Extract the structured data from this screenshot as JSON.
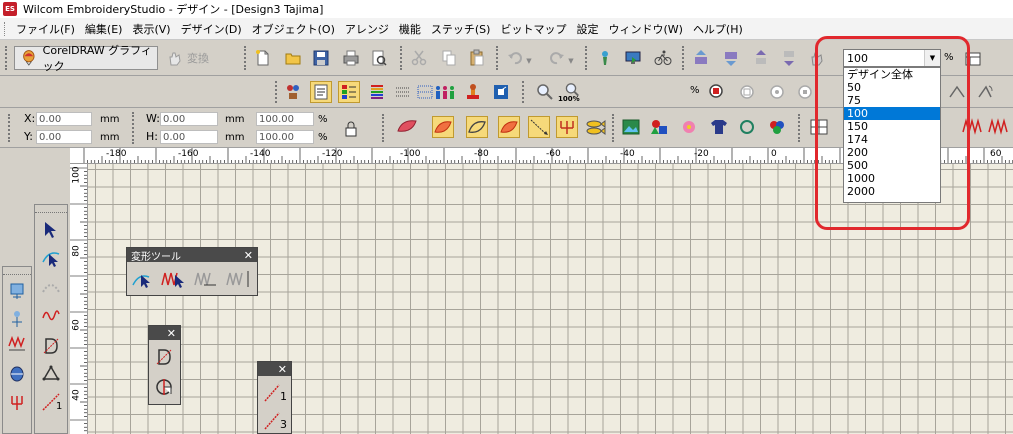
{
  "window": {
    "title": "Wilcom EmbroideryStudio - デザイン - [Design3        Tajima]",
    "logo_text": "ES"
  },
  "menu": [
    "ファイル(F)",
    "編集(E)",
    "表示(V)",
    "デザイン(D)",
    "オブジェクト(O)",
    "アレンジ",
    "機能",
    "ステッチ(S)",
    "ビットマップ",
    "設定",
    "ウィンドウ(W)",
    "ヘルプ(H)"
  ],
  "toolbar": {
    "coreldraw_label": "CorelDRAW グラフィック",
    "convert_label": "変換",
    "zoom_badge": "100%"
  },
  "zoom_combo": {
    "value": "100",
    "percent": "%"
  },
  "zoom_field": {
    "value": "100",
    "percent": "%"
  },
  "zoom_options": [
    "デザイン全体",
    "50",
    "75",
    "100",
    "150",
    "174",
    "200",
    "500",
    "1000",
    "2000"
  ],
  "zoom_selected_index": 3,
  "props": {
    "x_label": "X:",
    "x_value": "0.00",
    "y_label": "Y:",
    "y_value": "0.00",
    "w_label": "W:",
    "w_value": "0.00",
    "h_label": "H:",
    "h_value": "0.00",
    "unit": "mm",
    "scale_w": "100.00",
    "scale_h": "100.00",
    "percent": "%"
  },
  "ruler_top_labels": [
    "-180",
    "-160",
    "-140",
    "-120",
    "-100",
    "-80",
    "-60",
    "-40",
    "-20",
    "0",
    "60"
  ],
  "ruler_left_labels": [
    "100",
    "80",
    "60",
    "40"
  ],
  "panels": {
    "transform_tools": {
      "title": "変形ツール",
      "close": "✕"
    },
    "panel_small": {
      "close": "✕"
    },
    "panel_small2": {
      "close": "✕",
      "label1": "1",
      "label3": "3"
    }
  },
  "palette_labels": {
    "num1": "1"
  },
  "colors": {
    "highlight": "#e1282d",
    "selection": "#0078d7",
    "canvas": "#efece0"
  }
}
